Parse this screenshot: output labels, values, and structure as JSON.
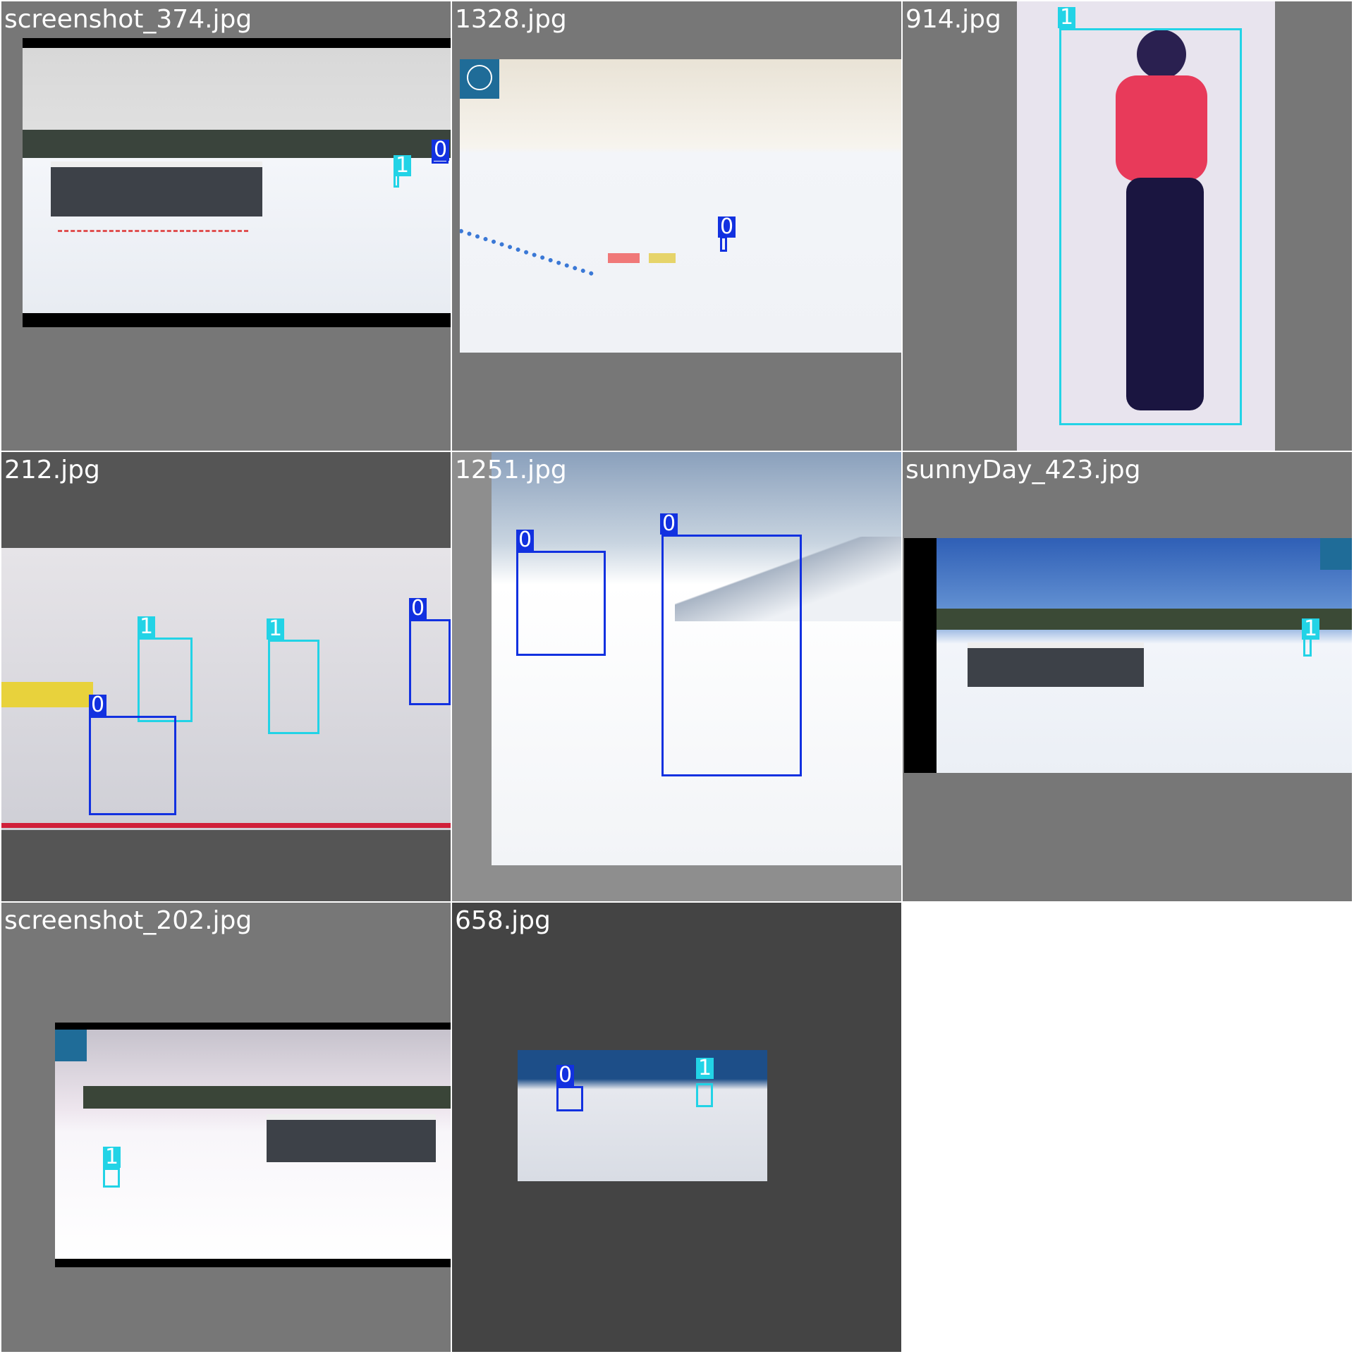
{
  "tiles": [
    {
      "name": "screenshot_374.jpg",
      "labels": [
        "1",
        "0"
      ]
    },
    {
      "name": "1328.jpg",
      "labels": [
        "0"
      ]
    },
    {
      "name": "914.jpg",
      "labels": [
        "1"
      ]
    },
    {
      "name": "212.jpg",
      "labels": [
        "1",
        "1",
        "0",
        "0"
      ]
    },
    {
      "name": "1251.jpg",
      "labels": [
        "0",
        "0"
      ]
    },
    {
      "name": "sunnyDay_423.jpg",
      "labels": [
        "1"
      ]
    },
    {
      "name": "screenshot_202.jpg",
      "labels": [
        "1"
      ]
    },
    {
      "name": "658.jpg",
      "labels": [
        "0",
        "1"
      ]
    }
  ],
  "colors": {
    "class_0": "#1231e0",
    "class_1": "#22d3e6",
    "tile_bg": "#777777",
    "tile_bg_dark": "#444444"
  }
}
